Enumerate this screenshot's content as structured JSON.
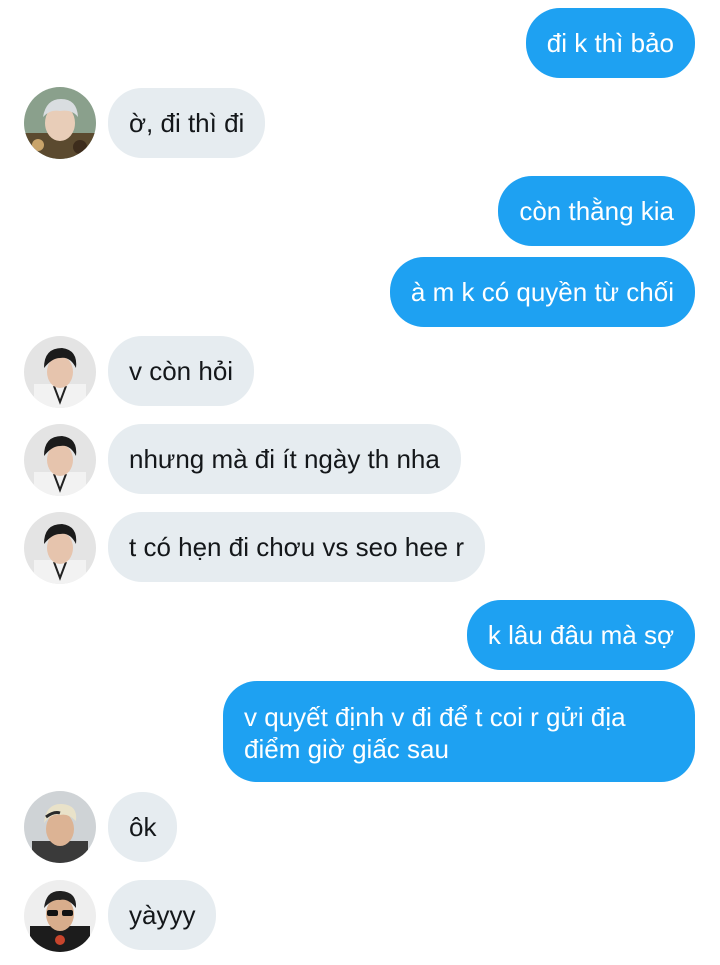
{
  "conversation": {
    "messages": [
      {
        "id": "m1",
        "sender": "self",
        "text": "đi k thì bảo"
      },
      {
        "id": "m2",
        "sender": "contact-1",
        "avatar": "avatar-grey-hair",
        "text": "ờ, đi thì đi"
      },
      {
        "id": "m3",
        "sender": "self",
        "text": "còn thằng kia"
      },
      {
        "id": "m4",
        "sender": "self",
        "text": "à m k có quyền từ chối"
      },
      {
        "id": "m5",
        "sender": "contact-2",
        "avatar": "avatar-dark-hair",
        "text": "v còn hỏi"
      },
      {
        "id": "m6",
        "sender": "contact-2",
        "avatar": "avatar-dark-hair",
        "text": "nhưng mà đi ít ngày th nha"
      },
      {
        "id": "m7",
        "sender": "contact-2",
        "avatar": "avatar-dark-hair",
        "text": "t có hẹn đi chơu vs seo hee r"
      },
      {
        "id": "m8",
        "sender": "self",
        "text": "k lâu đâu mà sợ"
      },
      {
        "id": "m9",
        "sender": "self",
        "text": "v quyết định v đi để t coi r gửi địa điểm giờ giấc sau"
      },
      {
        "id": "m10",
        "sender": "contact-3",
        "avatar": "avatar-bleached-hair",
        "text": "ôk"
      },
      {
        "id": "m11",
        "sender": "contact-4",
        "avatar": "avatar-sunglasses",
        "text": "yàyyy"
      }
    ]
  },
  "colors": {
    "outgoing_bubble": "#1ea1f2",
    "incoming_bubble": "#e6ecf0",
    "outgoing_text": "#ffffff",
    "incoming_text": "#14171a"
  }
}
